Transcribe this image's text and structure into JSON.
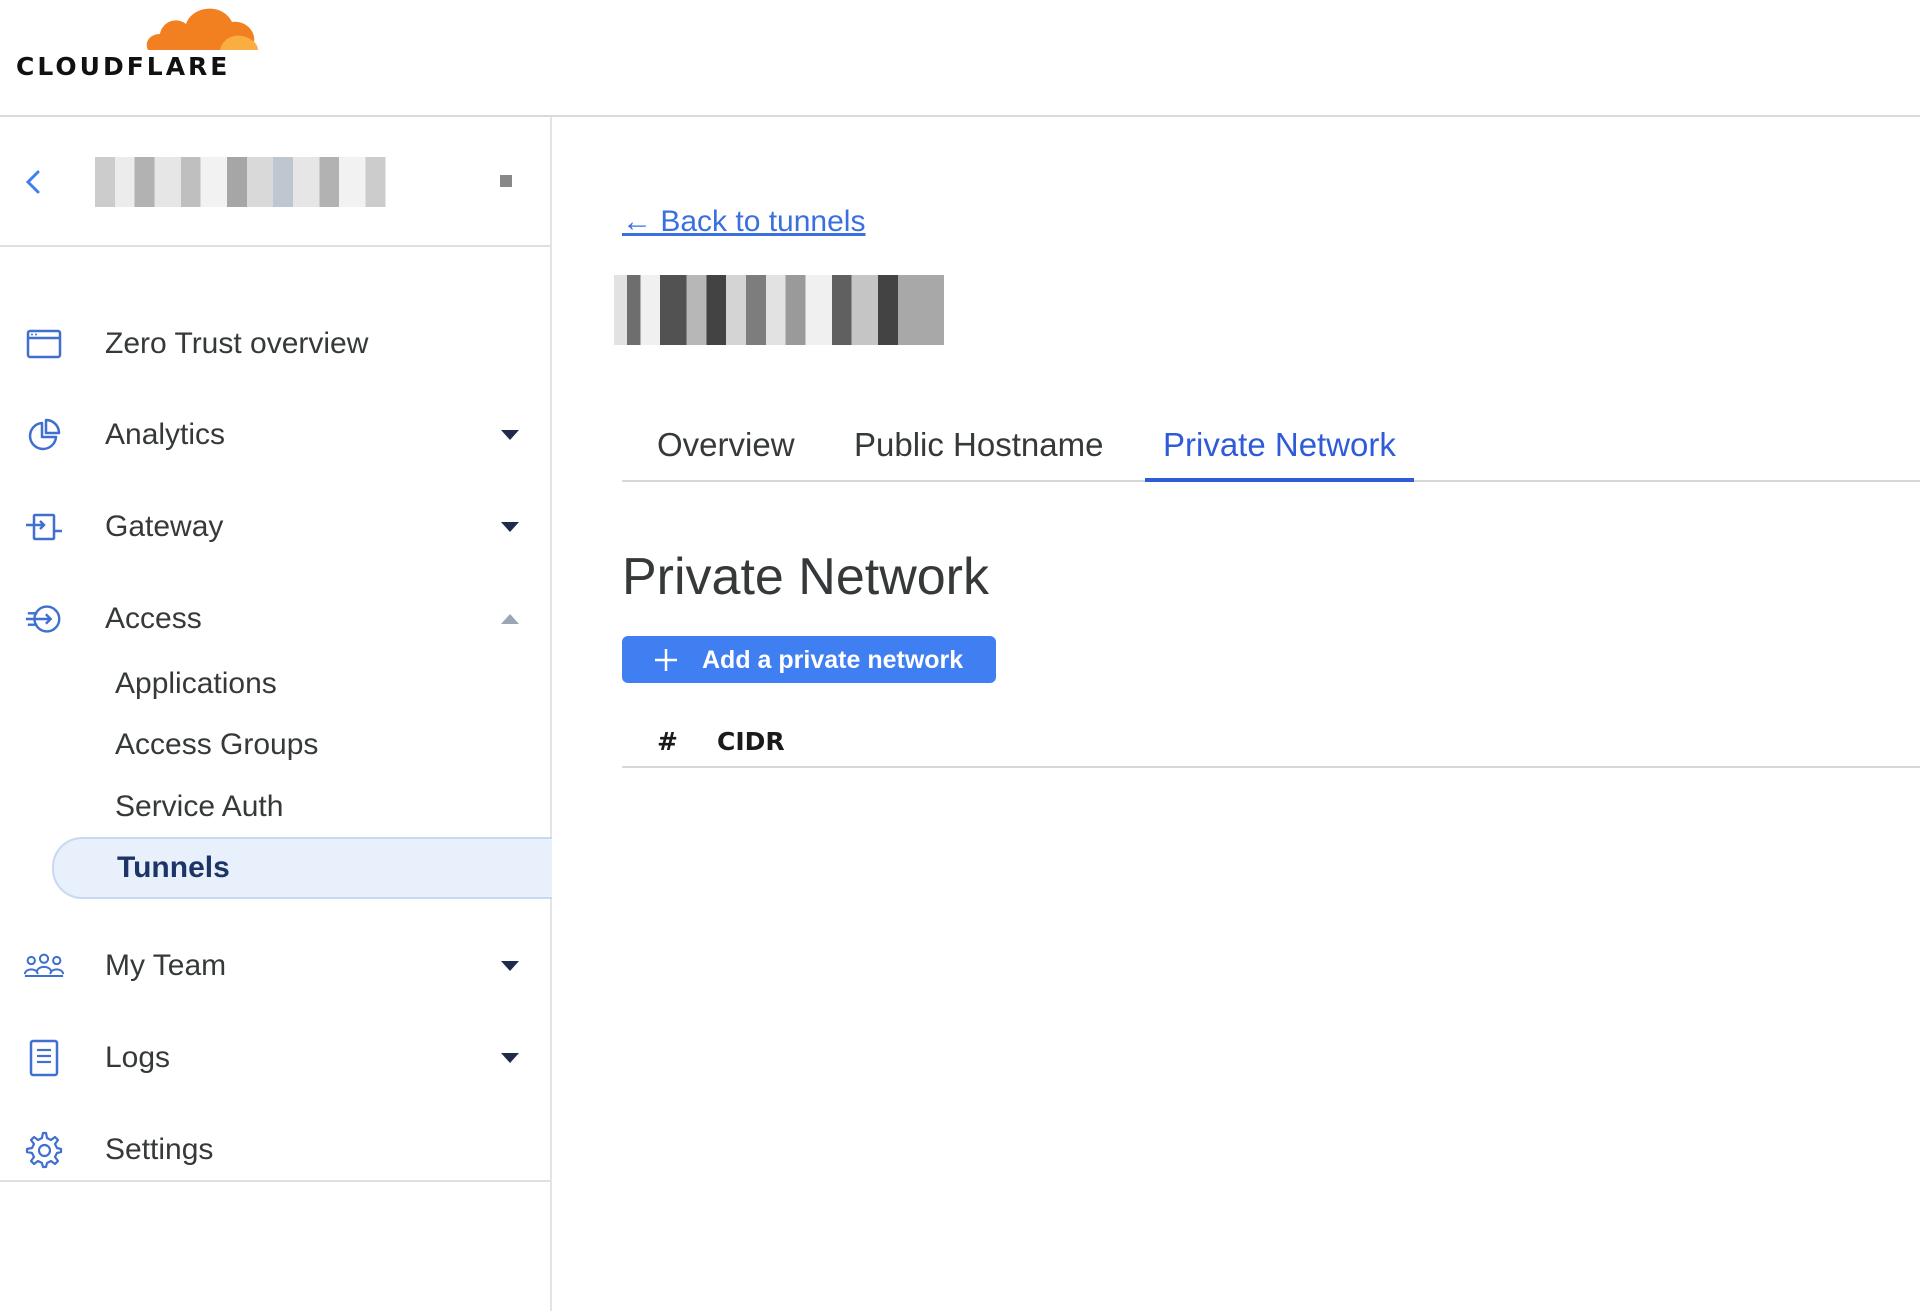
{
  "brand": {
    "name": "CLOUDFLARE",
    "cloud_color": "#f38020"
  },
  "account": {
    "name": "██████████ █"
  },
  "sidebar": {
    "items": [
      {
        "label": "Zero Trust overview",
        "icon": "browser-window-icon",
        "caret": "none"
      },
      {
        "label": "Analytics",
        "icon": "pie-chart-icon",
        "caret": "down"
      },
      {
        "label": "Gateway",
        "icon": "gateway-icon",
        "caret": "down"
      },
      {
        "label": "Access",
        "icon": "access-icon",
        "caret": "up"
      },
      {
        "label": "My Team",
        "icon": "team-icon",
        "caret": "down"
      },
      {
        "label": "Logs",
        "icon": "logs-icon",
        "caret": "down"
      },
      {
        "label": "Settings",
        "icon": "gear-icon",
        "caret": "none"
      }
    ],
    "access_sub": [
      {
        "label": "Applications"
      },
      {
        "label": "Access Groups"
      },
      {
        "label": "Service Auth"
      },
      {
        "label": "Tunnels",
        "active": true
      }
    ]
  },
  "main": {
    "back_link": "← Back to tunnels",
    "tunnel_name": "████████",
    "tabs": [
      {
        "label": "Overview"
      },
      {
        "label": "Public Hostname"
      },
      {
        "label": "Private Network",
        "active": true
      }
    ],
    "section_title": "Private Network",
    "add_button": "Add a private network",
    "table_headers": [
      "#",
      "CIDR"
    ]
  },
  "colors": {
    "accent": "#2f5bd9",
    "button": "#3f7ff2",
    "active_bg": "#e8f0fb"
  }
}
